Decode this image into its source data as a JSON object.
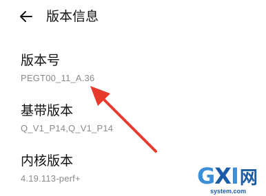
{
  "header": {
    "back_icon": "arrow-left-icon",
    "title": "版本信息"
  },
  "items": [
    {
      "title": "版本号",
      "value": "PEGT00_11_A.36"
    },
    {
      "title": "基带版本",
      "value": "Q_V1_P14,Q_V1_P14"
    },
    {
      "title": "内核版本",
      "value": "4.19.113-perf+"
    }
  ],
  "annotation": {
    "icon": "red-arrow-annotation",
    "color": "#e83a2c"
  },
  "watermark": {
    "logo_g": "G",
    "logo_x": "X",
    "logo_i": "I",
    "logo_net": "网",
    "domain": "system.com",
    "colors": {
      "primary": "#1b5ca8",
      "secondary": "#3a8fd8"
    }
  }
}
